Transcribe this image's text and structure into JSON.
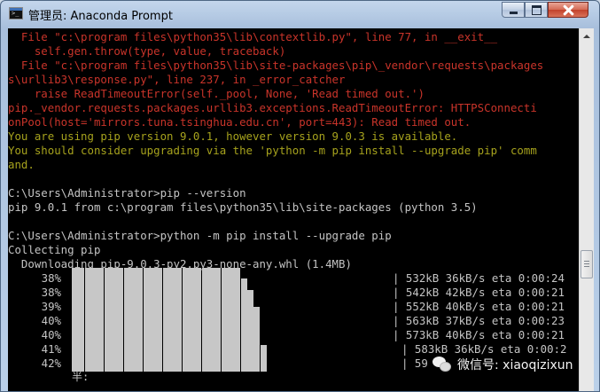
{
  "window": {
    "title": "管理员: Anaconda Prompt",
    "buttons": {
      "minimize": "minimize",
      "maximize": "maximize",
      "close": "close"
    }
  },
  "console": {
    "colors": {
      "error": "#c9342a",
      "warning": "#a6a21d",
      "normal": "#c4c4c4",
      "background": "#000000"
    },
    "lines": [
      {
        "text": "  File \"c:\\program files\\python35\\lib\\contextlib.py\", line 77, in __exit__",
        "color": "red"
      },
      {
        "text": "    self.gen.throw(type, value, traceback)",
        "color": "red"
      },
      {
        "text": "  File \"c:\\program files\\python35\\lib\\site-packages\\pip\\_vendor\\requests\\packages",
        "color": "red"
      },
      {
        "text": "s\\urllib3\\response.py\", line 237, in _error_catcher",
        "color": "red"
      },
      {
        "text": "    raise ReadTimeoutError(self._pool, None, 'Read timed out.')",
        "color": "red"
      },
      {
        "text": "pip._vendor.requests.packages.urllib3.exceptions.ReadTimeoutError: HTTPSConnecti",
        "color": "red"
      },
      {
        "text": "onPool(host='mirrors.tuna.tsinghua.edu.cn', port=443): Read timed out.",
        "color": "red"
      },
      {
        "text": "You are using pip version 9.0.1, however version 9.0.3 is available.",
        "color": "yellow"
      },
      {
        "text": "You should consider upgrading via the 'python -m pip install --upgrade pip' comm",
        "color": "yellow"
      },
      {
        "text": "and.",
        "color": "yellow"
      },
      {
        "text": "",
        "color": "white"
      },
      {
        "text": "C:\\Users\\Administrator>pip --version",
        "color": "white"
      },
      {
        "text": "pip 9.0.1 from c:\\program files\\python35\\lib\\site-packages (python 3.5)",
        "color": "white"
      },
      {
        "text": "",
        "color": "white"
      },
      {
        "text": "C:\\Users\\Administrator>python -m pip install --upgrade pip",
        "color": "white"
      },
      {
        "text": "Collecting pip",
        "color": "white"
      },
      {
        "text": "  Downloading pip-9.0.3-py2.py3-none-any.whl (1.4MB)",
        "color": "white"
      }
    ],
    "progress_rows": [
      {
        "percent": "38%",
        "progress": 0.38,
        "stat": "| 532kB 36kB/s eta 0:00:24"
      },
      {
        "percent": "38%",
        "progress": 0.38,
        "stat": "| 542kB 42kB/s eta 0:00:21"
      },
      {
        "percent": "39%",
        "progress": 0.39,
        "stat": "| 552kB 40kB/s eta 0:00:21"
      },
      {
        "percent": "40%",
        "progress": 0.4,
        "stat": "| 563kB 37kB/s eta 0:00:23"
      },
      {
        "percent": "40%",
        "progress": 0.4,
        "stat": "| 573kB 40kB/s eta 0:00:21"
      },
      {
        "percent": "41%",
        "progress": 0.41,
        "stat": "| 583kB 36kB/s eta 0:00:2"
      },
      {
        "percent": "42%",
        "progress": 0.42,
        "stat": "| 59"
      }
    ],
    "ime_indicator": "半:"
  },
  "watermark": {
    "text": "微信号: xiaoqizixun",
    "icon": "wechat-icon"
  }
}
